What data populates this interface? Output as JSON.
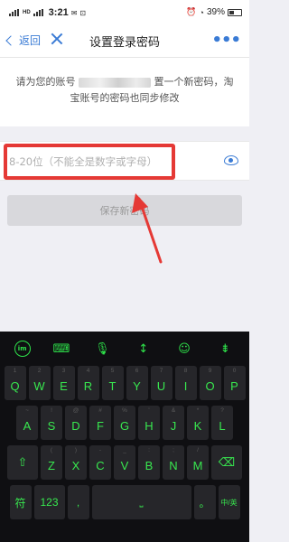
{
  "status_bar": {
    "time": "3:21",
    "network_badge": "HD",
    "battery_percent": "39%"
  },
  "nav": {
    "back_label": "返回",
    "title": "设置登录密码",
    "more_label": "•••"
  },
  "tip": {
    "line_prefix": "请为您的账号",
    "line_suffix": "置一个新密码，淘宝账号的密码也同步修改"
  },
  "password_field": {
    "placeholder": "8-20位（不能全是数字或字母）",
    "value": ""
  },
  "save_button": {
    "label": "保存新密码",
    "state": "disabled"
  },
  "keyboard": {
    "theme_color": "#38e84f",
    "toolbar": [
      "ime-logo",
      "keyboard-icon",
      "microphone-icon",
      "cursor-move-icon",
      "emoji-icon",
      "collapse-keyboard-icon"
    ],
    "row1": [
      {
        "key": "Q",
        "hint": "1"
      },
      {
        "key": "W",
        "hint": "2"
      },
      {
        "key": "E",
        "hint": "3"
      },
      {
        "key": "R",
        "hint": "4"
      },
      {
        "key": "T",
        "hint": "5"
      },
      {
        "key": "Y",
        "hint": "6"
      },
      {
        "key": "U",
        "hint": "7"
      },
      {
        "key": "I",
        "hint": "8"
      },
      {
        "key": "O",
        "hint": "9"
      },
      {
        "key": "P",
        "hint": "0"
      }
    ],
    "row2": [
      {
        "key": "A",
        "hint": "~"
      },
      {
        "key": "S",
        "hint": "!"
      },
      {
        "key": "D",
        "hint": "@"
      },
      {
        "key": "F",
        "hint": "#"
      },
      {
        "key": "G",
        "hint": "%"
      },
      {
        "key": "H",
        "hint": "'"
      },
      {
        "key": "J",
        "hint": "&"
      },
      {
        "key": "K",
        "hint": "*"
      },
      {
        "key": "L",
        "hint": "?"
      }
    ],
    "row3": [
      {
        "key": "Z",
        "hint": "("
      },
      {
        "key": "X",
        "hint": ")"
      },
      {
        "key": "C",
        "hint": "-"
      },
      {
        "key": "V",
        "hint": "_"
      },
      {
        "key": "B",
        "hint": ":"
      },
      {
        "key": "N",
        "hint": ";"
      },
      {
        "key": "M",
        "hint": "/"
      }
    ],
    "symbol_key": "符",
    "number_key": "123",
    "comma_key": ",",
    "period_key": "。",
    "chinese_english_key": "中/英"
  }
}
